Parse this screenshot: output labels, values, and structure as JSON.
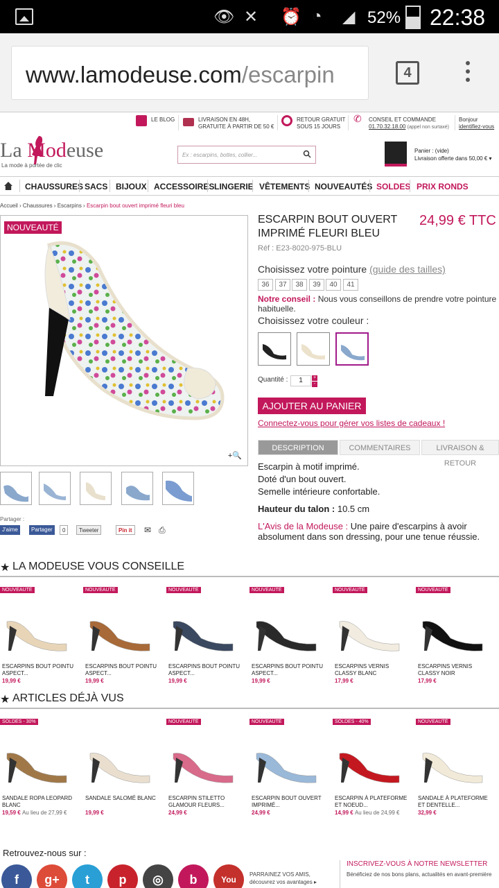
{
  "status": {
    "battery": "52%",
    "time": "22:38"
  },
  "browser": {
    "url_host": "www.lamodeuse.com",
    "url_path": "/escarpin",
    "tab_count": "4"
  },
  "topbar": {
    "blog": "LE BLOG",
    "livraison": [
      "LIVRAISON EN 48H,",
      "GRATUITE À PARTIR DE 50 €"
    ],
    "retour": [
      "RETOUR GRATUIT",
      "SOUS 15 JOURS"
    ],
    "conseil": [
      "CONSEIL ET COMMANDE",
      "01.70.32.18.00",
      "(appel non surtaxé)"
    ],
    "bonjour": [
      "Bonjour",
      "identifiez-vous"
    ]
  },
  "logo": {
    "la": "La ",
    "mod": "Mod",
    "euse": "euse",
    "tagline": "La mode à portée de clic"
  },
  "search": {
    "placeholder": "Ex : escarpins, bottes, collier..."
  },
  "cart": {
    "line1": "Panier : (vide)",
    "line2": "Livraison offerte dans 50,00 € ▾"
  },
  "nav": [
    "CHAUSSURES",
    "SACS",
    "BIJOUX",
    "ACCESSOIRES",
    "LINGERIE",
    "VÊTEMENTS",
    "NOUVEAUTÉS",
    "SOLDES",
    "PRIX RONDS"
  ],
  "breadcrumb": {
    "path": "Accueil › Chaussures › Escarpins › ",
    "current": "Escarpin bout ouvert imprimé fleuri bleu"
  },
  "product": {
    "badge": "NOUVEAUTÉ",
    "title": "ESCARPIN BOUT OUVERT IMPRIMÉ FLEURI BLEU",
    "price": "24,99 € TTC",
    "ref": "Réf : E23-8020-975-BLU",
    "size_label": "Choisissez votre pointure ",
    "size_guide": "(guide des tailles)",
    "sizes": [
      "36",
      "37",
      "38",
      "39",
      "40",
      "41"
    ],
    "conseil_label": "Notre conseil : ",
    "conseil_text": "Nous vous conseillons de prendre votre pointure habituelle.",
    "color_label": "Choisissez votre couleur :",
    "qty_label": "Quantité :",
    "qty": "1",
    "add_to_cart": "AJOUTER AU PANIER",
    "gift_link": "Connectez-vous pour gérer vos listes de cadeaux !",
    "tabs": [
      "DESCRIPTION",
      "COMMENTAIRES",
      "LIVRAISON & RETOUR"
    ],
    "desc": [
      "Escarpin à motif imprimé.",
      "Doté d'un bout ouvert.",
      "Semelle intérieure confortable."
    ],
    "talon_label": "Hauteur du talon : ",
    "talon_val": "10.5 cm",
    "avis_label": "L'Avis de la Modeuse : ",
    "avis_text": "Une paire d'escarpins à avoir absolument dans son dressing, pour une tenue réussie."
  },
  "share": {
    "label": "Partager :",
    "jaime": "J'aime",
    "partager": "Partager",
    "count": "0",
    "tweet": "Tweeter",
    "pin": "Pin it"
  },
  "sections": {
    "conseille": "LA MODEUSE VOUS CONSEILLE",
    "vus": "ARTICLES DÉJÀ VUS"
  },
  "conseille": [
    {
      "badge": "NOUVEAUTÉ",
      "name": "ESCARPINS BOUT POINTU ASPECT...",
      "price": "19,99 €",
      "color": "#e8d5b8"
    },
    {
      "badge": "NOUVEAUTÉ",
      "name": "ESCARPINS BOUT POINTU ASPECT...",
      "price": "19,99 €",
      "color": "#a86a38"
    },
    {
      "badge": "NOUVEAUTÉ",
      "name": "ESCARPINS BOUT POINTU ASPECT...",
      "price": "19,99 €",
      "color": "#3a4860"
    },
    {
      "badge": "NOUVEAUTÉ",
      "name": "ESCARPINS BOUT POINTU ASPECT...",
      "price": "19,99 €",
      "color": "#2a2a2a"
    },
    {
      "badge": "NOUVEAUTÉ",
      "name": "ESCARPINS VERNIS CLASSY BLANC",
      "price": "17,99 €",
      "color": "#f2ece0"
    },
    {
      "badge": "NOUVEAUTÉ",
      "name": "ESCARPINS VERNIS CLASSY NOIR",
      "price": "17,99 €",
      "color": "#111111"
    }
  ],
  "vus": [
    {
      "badge": "SOLDES - 30%",
      "name": "SANDALE ROPA LEOPARD BLANC",
      "price": "19,59 €",
      "old": "Au lieu de 27,99 €",
      "color": "#a07848"
    },
    {
      "badge": "",
      "name": "SANDALE SALOMÉ BLANC",
      "price": "19,99 €",
      "old": "",
      "color": "#eadfcf"
    },
    {
      "badge": "NOUVEAUTÉ",
      "name": "ESCARPIN STILETTO GLAMOUR FLEURS...",
      "price": "24,99 €",
      "old": "",
      "color": "#d86a8a"
    },
    {
      "badge": "NOUVEAUTÉ",
      "name": "ESCARPIN BOUT OUVERT IMPRIMÉ...",
      "price": "24,99 €",
      "old": "",
      "color": "#9ab8d8"
    },
    {
      "badge": "SOLDES - 40%",
      "name": "ESCARPIN À PLATEFORME ET NOEUD...",
      "price": "14,99 €",
      "old": "Au lieu de 24,99 €",
      "color": "#c41820"
    },
    {
      "badge": "NOUVEAUTÉ",
      "name": "SANDALE À PLATEFORME ET DENTELLE...",
      "price": "32,99 €",
      "old": "",
      "color": "#f2ead8"
    }
  ],
  "footer": {
    "retrouvez": "Retrouvez-nous sur :",
    "parrainez": [
      "PARRAINEZ VOS AMIS,",
      "découvrez vos avantages ▸"
    ],
    "newsletter": "INSCRIVEZ-VOUS À NOTRE NEWSLETTER",
    "newsletter_desc": "Bénéficiez de nos bons plans, actualités en avant-première"
  },
  "colors": {
    "accent": "#c2185b"
  }
}
